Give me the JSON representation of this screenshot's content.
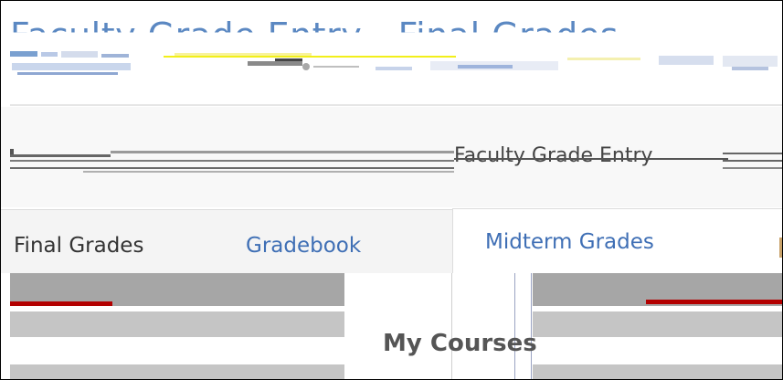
{
  "header": {
    "title": "Faculty Grade Entry - Final Grades"
  },
  "breadcrumb": {
    "current": "Faculty Grade Entry"
  },
  "tabs": [
    {
      "label": "Final Grades",
      "active": false
    },
    {
      "label": "Gradebook",
      "active": false
    },
    {
      "label": "Midterm Grades",
      "active": true
    }
  ],
  "section": {
    "title": "My Courses"
  },
  "colors": {
    "link": "#3f6fb5",
    "accent_red": "#b30000",
    "text_dark": "#333333"
  }
}
